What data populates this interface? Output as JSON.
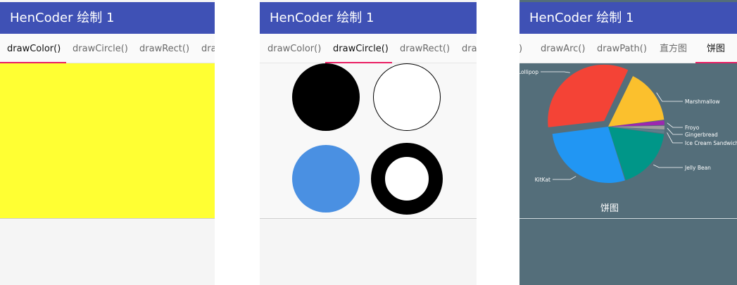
{
  "screens": [
    {
      "title": "HenCoder 绘制 1",
      "tabs": [
        "drawColor()",
        "drawCircle()",
        "drawRect()",
        "dra"
      ],
      "active_tab": "drawColor()",
      "canvas_color": "#ffff33"
    },
    {
      "title": "HenCoder 绘制 1",
      "tabs": [
        "drawColor()",
        "drawCircle()",
        "drawRect()",
        "dra"
      ],
      "active_tab": "drawCircle()",
      "circles": [
        {
          "style": "fill",
          "color": "#000000"
        },
        {
          "style": "stroke",
          "color": "#000000"
        },
        {
          "style": "fill",
          "color": "#4a90e2"
        },
        {
          "style": "thick-stroke",
          "color": "#000000"
        }
      ]
    },
    {
      "title": "HenCoder 绘制 1",
      "tabs": [
        ")",
        "drawArc()",
        "drawPath()",
        "直方图",
        "饼图"
      ],
      "active_tab": "饼图"
    }
  ],
  "chart_data": {
    "type": "pie",
    "title": "饼图",
    "background": "#546e7a",
    "slices": [
      {
        "label": "Lollipop",
        "value": 34,
        "color": "#f44336"
      },
      {
        "label": "Marshmallow",
        "value": 16,
        "color": "#fbc02d"
      },
      {
        "label": "Froyo",
        "value": 1.5,
        "color": "#9c27b0"
      },
      {
        "label": "Gingerbread",
        "value": 1.3,
        "color": "#9e9e9e"
      },
      {
        "label": "Ice Cream Sandwich",
        "value": 1.1,
        "color": "#607d8b"
      },
      {
        "label": "Jelly Bean",
        "value": 18,
        "color": "#009688"
      },
      {
        "label": "KitKat",
        "value": 28,
        "color": "#2196f3"
      }
    ]
  }
}
